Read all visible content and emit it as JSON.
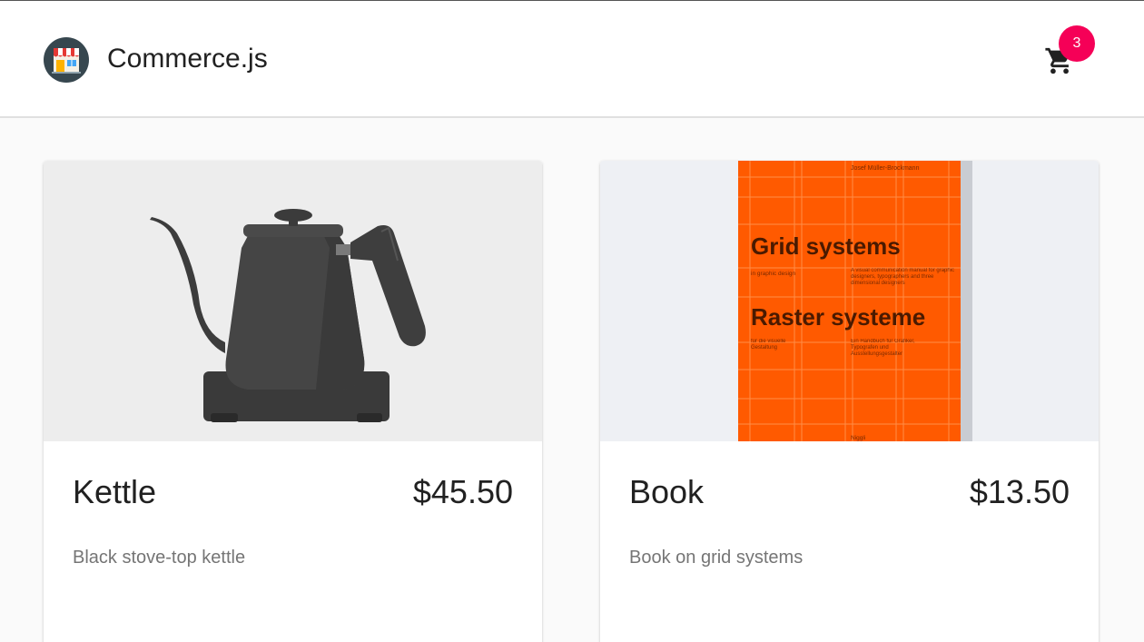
{
  "header": {
    "brand": "Commerce.js",
    "logo_icon": "storefront-icon",
    "cart_icon": "shopping-cart-icon",
    "cart_count": "3",
    "badge_color": "#f50057"
  },
  "products": [
    {
      "name": "Kettle",
      "price": "$45.50",
      "description": "Black stove-top kettle",
      "image_icon": "kettle-image"
    },
    {
      "name": "Book",
      "price": "$13.50",
      "description": "Book on grid systems",
      "image_icon": "book-cover-image",
      "cover": {
        "author": "Josef Müller-Brockmann",
        "title_en": "Grid systems",
        "subtitle_en": "in graphic design",
        "blurb_en": "A visual communication manual for graphic designers, typographers and three dimensional designers",
        "title_de": "Raster systeme",
        "subtitle_de": "für die visuelle Gestaltung",
        "blurb_de": "Ein Handbuch für Grafiker, Typografen und Ausstellungsgestalter",
        "publisher": "Niggli",
        "cover_color": "#ff5a00"
      }
    }
  ]
}
